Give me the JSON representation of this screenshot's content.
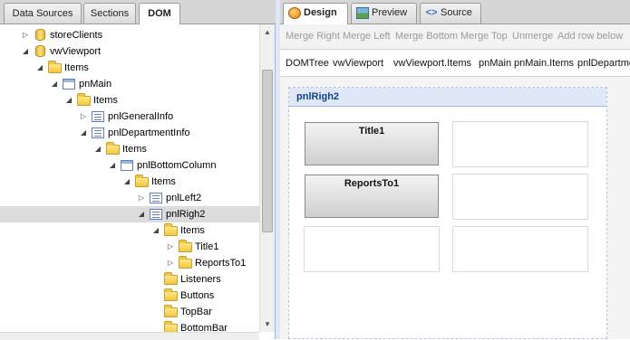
{
  "left_tabs": [
    "Data Sources",
    "Sections",
    "DOM"
  ],
  "tree": [
    {
      "label": "storeClients",
      "icon": "database-icon",
      "expander": "collapsed"
    },
    {
      "label": "vwViewport",
      "icon": "database-icon",
      "expander": "expanded"
    },
    {
      "label": "Items",
      "icon": "folder-icon",
      "expander": "expanded"
    },
    {
      "label": "pnMain",
      "icon": "panel-icon",
      "expander": "expanded"
    },
    {
      "label": "Items",
      "icon": "folder-icon",
      "expander": "expanded"
    },
    {
      "label": "pnlGeneralInfo",
      "icon": "form-panel-icon",
      "expander": "collapsed"
    },
    {
      "label": "pnlDepartmentInfo",
      "icon": "form-panel-icon",
      "expander": "expanded"
    },
    {
      "label": "Items",
      "icon": "folder-icon",
      "expander": "expanded"
    },
    {
      "label": "pnlBottomColumn",
      "icon": "panel-icon",
      "expander": "expanded"
    },
    {
      "label": "Items",
      "icon": "folder-icon",
      "expander": "expanded"
    },
    {
      "label": "pnlLeft2",
      "icon": "form-panel-icon",
      "expander": "collapsed"
    },
    {
      "label": "pnlRigh2",
      "icon": "form-panel-icon",
      "expander": "expanded",
      "selected": true
    },
    {
      "label": "Items",
      "icon": "folder-icon",
      "expander": "expanded"
    },
    {
      "label": "Title1",
      "icon": "folder-icon",
      "expander": "collapsed"
    },
    {
      "label": "ReportsTo1",
      "icon": "folder-icon",
      "expander": "collapsed"
    },
    {
      "label": "Listeners",
      "icon": "folder-icon",
      "expander": "none"
    },
    {
      "label": "Buttons",
      "icon": "folder-icon",
      "expander": "none"
    },
    {
      "label": "TopBar",
      "icon": "folder-icon",
      "expander": "none"
    },
    {
      "label": "BottomBar",
      "icon": "folder-icon",
      "expander": "none"
    }
  ],
  "right_tabs": [
    {
      "label": "Design",
      "icon": "design-icon"
    },
    {
      "label": "Preview",
      "icon": "preview-icon"
    },
    {
      "label": "Source",
      "icon": "source-icon"
    }
  ],
  "toolbar": [
    "Merge Right",
    "Merge Left",
    "Merge Bottom",
    "Merge Top",
    "Unmerge",
    "Add row below"
  ],
  "breadcrumb": [
    "DOMTree",
    "vwViewport",
    "vwViewport.Items",
    "pnMain",
    "pnMain.Items",
    "pnlDepartme"
  ],
  "panel": {
    "title": "pnlRigh2",
    "buttons": [
      "Title1",
      "ReportsTo1"
    ]
  }
}
